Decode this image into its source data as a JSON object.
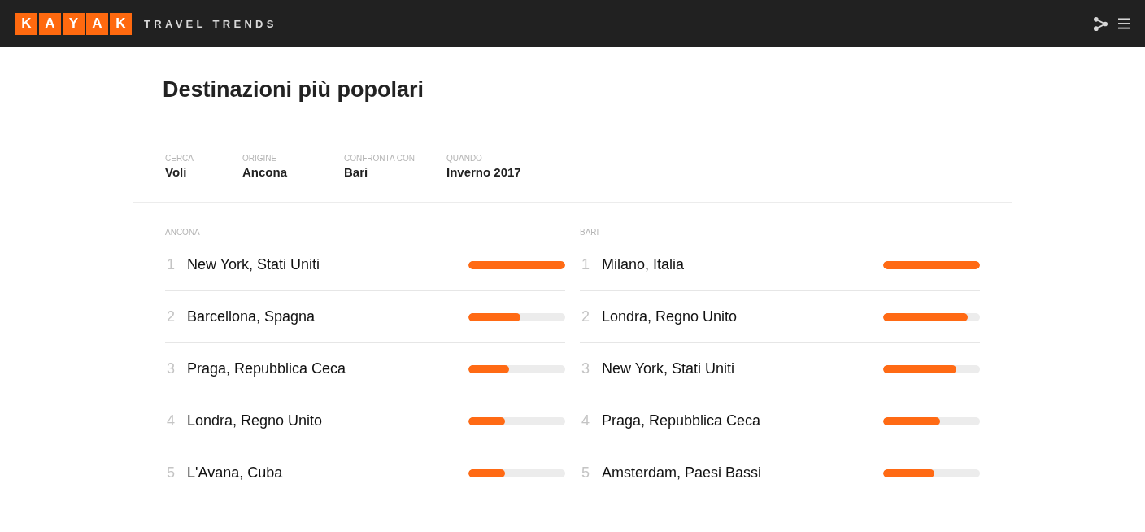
{
  "header": {
    "logo_letters": [
      "K",
      "A",
      "Y",
      "A",
      "K"
    ],
    "subtitle": "TRAVEL TRENDS"
  },
  "page": {
    "title": "Destinazioni più popolari"
  },
  "filters": [
    {
      "label": "CERCA",
      "value": "Voli"
    },
    {
      "label": "ORIGINE",
      "value": "Ancona"
    },
    {
      "label": "CONFRONTA CON",
      "value": "Bari"
    },
    {
      "label": "QUANDO",
      "value": "Inverno 2017"
    }
  ],
  "lists": [
    {
      "heading": "ANCONA",
      "rows": [
        {
          "rank": "1",
          "name": "New York, Stati Uniti",
          "level": 1.0
        },
        {
          "rank": "2",
          "name": "Barcellona, Spagna",
          "level": 0.54
        },
        {
          "rank": "3",
          "name": "Praga, Repubblica Ceca",
          "level": 0.42
        },
        {
          "rank": "4",
          "name": "Londra, Regno Unito",
          "level": 0.38
        },
        {
          "rank": "5",
          "name": "L'Avana, Cuba",
          "level": 0.38
        }
      ]
    },
    {
      "heading": "BARI",
      "rows": [
        {
          "rank": "1",
          "name": "Milano, Italia",
          "level": 1.0
        },
        {
          "rank": "2",
          "name": "Londra, Regno Unito",
          "level": 0.87
        },
        {
          "rank": "3",
          "name": "New York, Stati Uniti",
          "level": 0.76
        },
        {
          "rank": "4",
          "name": "Praga, Repubblica Ceca",
          "level": 0.59
        },
        {
          "rank": "5",
          "name": "Amsterdam, Paesi Bassi",
          "level": 0.53
        }
      ]
    }
  ]
}
